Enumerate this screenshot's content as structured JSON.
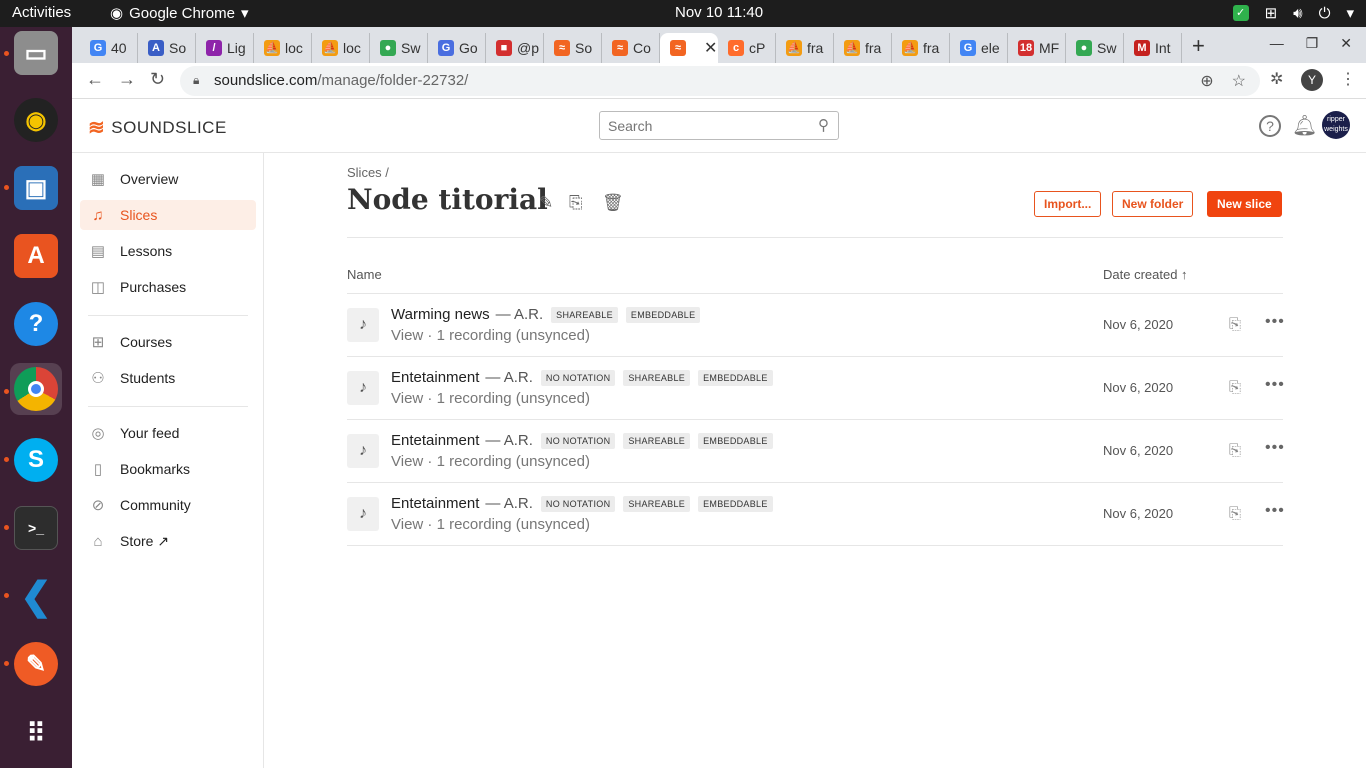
{
  "os": {
    "activities": "Activities",
    "app_name": "Google Chrome",
    "clock": "Nov 10  11:40"
  },
  "browser": {
    "tabs": [
      {
        "label": "40",
        "fav_color": "#4285f4",
        "fav": "G"
      },
      {
        "label": "So",
        "fav_color": "#3a5ec6",
        "fav": "A"
      },
      {
        "label": "Lig",
        "fav_color": "#8e24aa",
        "fav": "/"
      },
      {
        "label": "loc",
        "fav_color": "#f39c12",
        "fav": "⛵"
      },
      {
        "label": "loc",
        "fav_color": "#f39c12",
        "fav": "⛵"
      },
      {
        "label": "Sw",
        "fav_color": "#34a853",
        "fav": "●"
      },
      {
        "label": "Go",
        "fav_color": "#4a6ee0",
        "fav": "G"
      },
      {
        "label": "@p",
        "fav_color": "#d32f2f",
        "fav": "■"
      },
      {
        "label": "So",
        "fav_color": "#f26522",
        "fav": "≈"
      },
      {
        "label": "Co",
        "fav_color": "#f26522",
        "fav": "≈"
      },
      {
        "label": "",
        "fav_color": "#f26522",
        "fav": "≈",
        "active": true
      },
      {
        "label": "cP",
        "fav_color": "#ff6c2c",
        "fav": "c"
      },
      {
        "label": "fra",
        "fav_color": "#f39c12",
        "fav": "⛵"
      },
      {
        "label": "fra",
        "fav_color": "#f39c12",
        "fav": "⛵"
      },
      {
        "label": "fra",
        "fav_color": "#f39c12",
        "fav": "⛵"
      },
      {
        "label": "ele",
        "fav_color": "#4285f4",
        "fav": "G"
      },
      {
        "label": "MF",
        "fav_color": "#d32f2f",
        "fav": "18"
      },
      {
        "label": "Sw",
        "fav_color": "#34a853",
        "fav": "●"
      },
      {
        "label": "Int",
        "fav_color": "#c5221f",
        "fav": "M"
      }
    ],
    "url_host": "soundslice.com",
    "url_path": "/manage/folder-22732/",
    "profile_initial": "Y"
  },
  "site": {
    "logo_text": "SOUNDSLICE",
    "search_placeholder": "Search",
    "avatar_text": "ripper weights"
  },
  "sidebar": {
    "items": [
      {
        "label": "Overview",
        "icon": "grid-icon",
        "glyph": "▦"
      },
      {
        "label": "Slices",
        "icon": "music-file-icon",
        "glyph": "♫",
        "active": true
      },
      {
        "label": "Lessons",
        "icon": "easel-icon",
        "glyph": "▤"
      },
      {
        "label": "Purchases",
        "icon": "bag-icon",
        "glyph": "◫"
      },
      {
        "label": "Courses",
        "icon": "course-book-icon",
        "glyph": "⊞"
      },
      {
        "label": "Students",
        "icon": "users-icon",
        "glyph": "⚇"
      },
      {
        "label": "Your feed",
        "icon": "feed-icon",
        "glyph": "◎"
      },
      {
        "label": "Bookmarks",
        "icon": "bookmark-icon",
        "glyph": "▯"
      },
      {
        "label": "Community",
        "icon": "compass-icon",
        "glyph": "⊘"
      },
      {
        "label": "Store ↗",
        "icon": "store-icon",
        "glyph": "⌂"
      }
    ]
  },
  "main": {
    "breadcrumb": "Slices /",
    "title": "Node titorial",
    "buttons": {
      "import": "Import...",
      "new_folder": "New folder",
      "new_slice": "New slice"
    },
    "columns": {
      "name": "Name",
      "date": "Date created ↑"
    },
    "rows": [
      {
        "title": "Warming news",
        "artist": "— A.R.",
        "tags": [
          "SHAREABLE",
          "EMBEDDABLE"
        ],
        "subtitle": "View · 1 recording (unsynced)",
        "date": "Nov 6, 2020"
      },
      {
        "title": "Entetainment",
        "artist": "— A.R.",
        "tags": [
          "NO NOTATION",
          "SHAREABLE",
          "EMBEDDABLE"
        ],
        "subtitle": "View · 1 recording (unsynced)",
        "date": "Nov 6, 2020"
      },
      {
        "title": "Entetainment",
        "artist": "— A.R.",
        "tags": [
          "NO NOTATION",
          "SHAREABLE",
          "EMBEDDABLE"
        ],
        "subtitle": "View · 1 recording (unsynced)",
        "date": "Nov 6, 2020"
      },
      {
        "title": "Entetainment",
        "artist": "— A.R.",
        "tags": [
          "NO NOTATION",
          "SHAREABLE",
          "EMBEDDABLE"
        ],
        "subtitle": "View · 1 recording (unsynced)",
        "date": "Nov 6, 2020"
      }
    ]
  },
  "colors": {
    "accent": "#f0440f",
    "dock_bg": "#3a1f33",
    "sidebar_active_bg": "#fdeee6"
  }
}
